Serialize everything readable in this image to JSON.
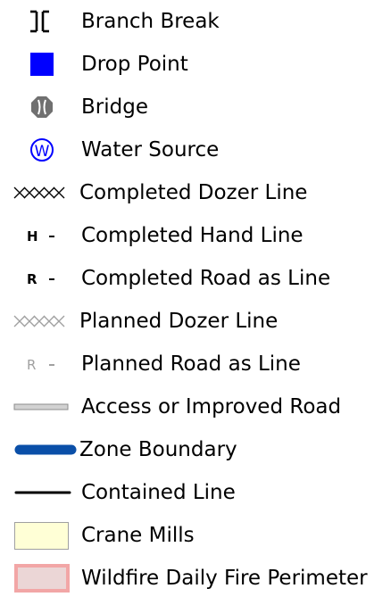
{
  "legend": {
    "items": [
      {
        "label": "Branch Break",
        "icon": "branch-break-icon"
      },
      {
        "label": "Drop Point",
        "icon": "drop-point-icon",
        "color": "#0000ff"
      },
      {
        "label": "Bridge",
        "icon": "bridge-icon",
        "color": "#707070"
      },
      {
        "label": "Water Source",
        "icon": "water-source-icon",
        "color": "#0000ff",
        "symbol_text": "W"
      },
      {
        "label": "Completed Dozer Line",
        "icon": "completed-dozer-line-icon",
        "color": "#000000"
      },
      {
        "label": "Completed Hand Line",
        "icon": "completed-hand-line-icon",
        "color": "#000000",
        "symbol_text": "H"
      },
      {
        "label": "Completed Road as Line",
        "icon": "completed-road-line-icon",
        "color": "#000000",
        "symbol_text": "R"
      },
      {
        "label": "Planned Dozer Line",
        "icon": "planned-dozer-line-icon",
        "color": "#a0a0a0"
      },
      {
        "label": "Planned Road as Line",
        "icon": "planned-road-line-icon",
        "color": "#a0a0a0",
        "symbol_text": "R"
      },
      {
        "label": "Access or Improved Road",
        "icon": "access-road-icon",
        "color": "#b4b4b4"
      },
      {
        "label": "Zone Boundary",
        "icon": "zone-boundary-icon",
        "color": "#0a4fa8"
      },
      {
        "label": "Contained Line",
        "icon": "contained-line-icon",
        "color": "#000000"
      },
      {
        "label": "Crane Mills",
        "icon": "crane-mills-icon",
        "color": "#ffffd6"
      },
      {
        "label": "Wildfire Daily Fire Perimeter",
        "icon": "fire-perimeter-icon",
        "color": "#f2a6a6"
      }
    ]
  }
}
